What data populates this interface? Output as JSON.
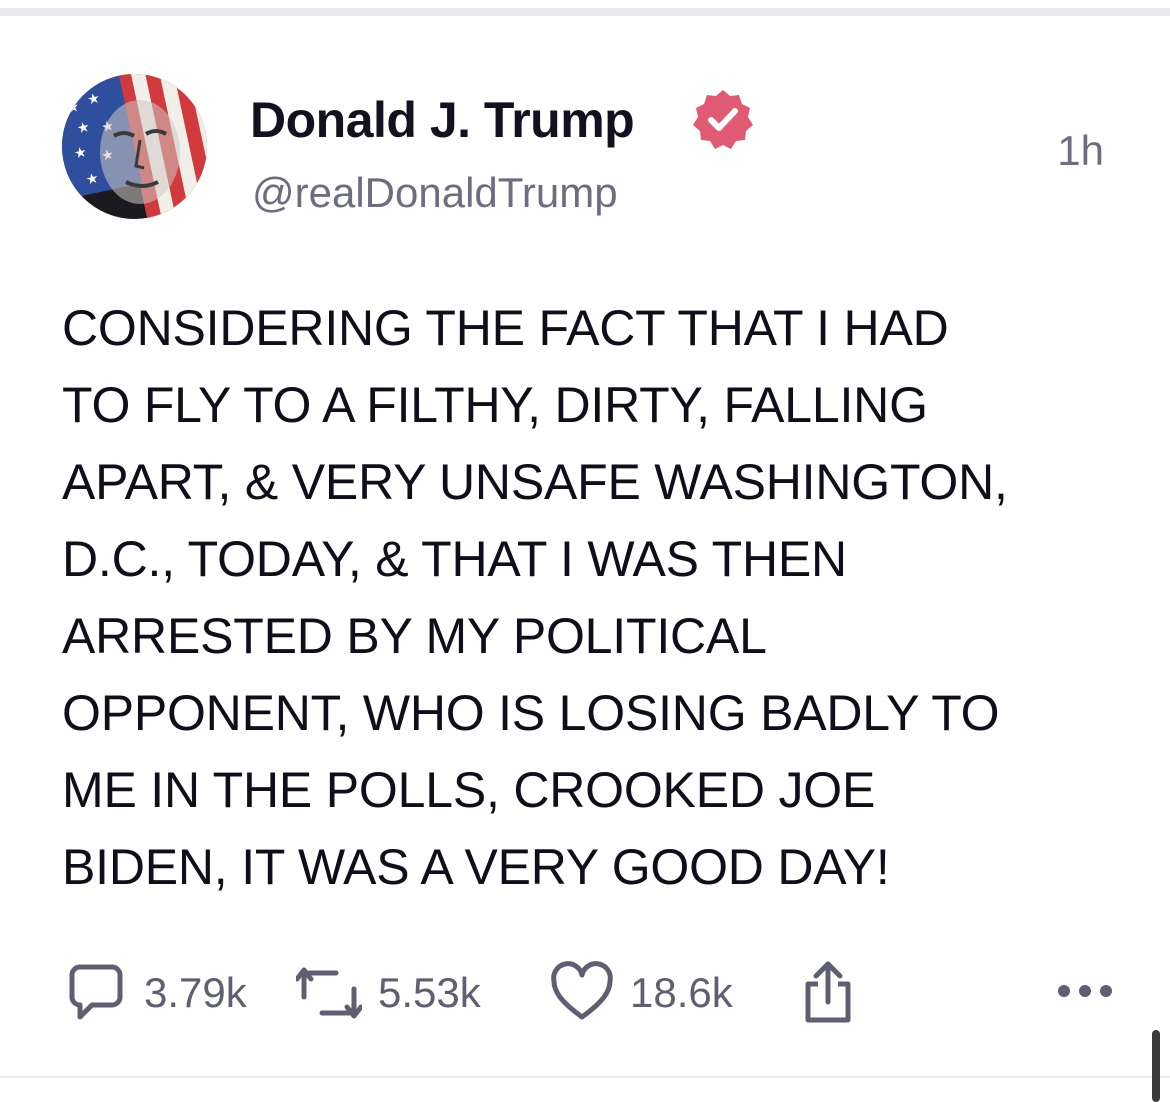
{
  "post": {
    "author": {
      "display_name": "Donald J. Trump",
      "handle": "@realDonaldTrump",
      "verified": true,
      "avatar_icon": "flag-portrait-avatar"
    },
    "timestamp": "1h",
    "body": "CONSIDERING THE FACT THAT I HAD\nTO FLY TO A FILTHY, DIRTY, FALLING\nAPART, & VERY UNSAFE WASHINGTON,\nD.C., TODAY, & THAT I WAS THEN\nARRESTED BY MY POLITICAL\nOPPONENT, WHO IS LOSING BADLY TO\nME IN THE POLLS, CROOKED JOE\nBIDEN, IT WAS A VERY GOOD DAY!",
    "actions": {
      "replies": {
        "icon": "reply-icon",
        "count": "3.79k"
      },
      "retruths": {
        "icon": "repost-icon",
        "count": "5.53k"
      },
      "likes": {
        "icon": "heart-icon",
        "count": "18.6k"
      },
      "share": {
        "icon": "share-icon"
      },
      "more": {
        "icon": "more-icon"
      }
    }
  },
  "colors": {
    "verified_badge": "#e05a73",
    "text_primary": "#0f0f1a",
    "text_secondary": "#6d6d80"
  }
}
